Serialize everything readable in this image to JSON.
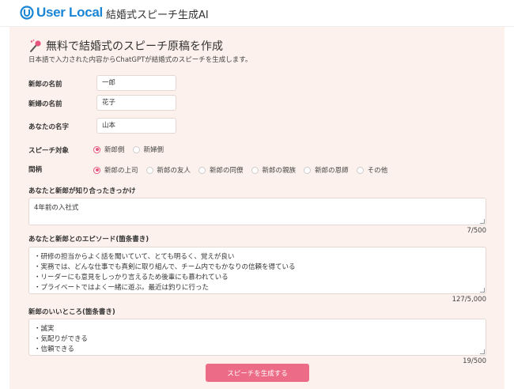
{
  "header": {
    "logo_text": "User Local",
    "app_title": "結婚式スピーチ生成AI",
    "brand_color": "#1a86d6"
  },
  "page": {
    "title": "無料で結婚式のスピーチ原稿を作成",
    "subtitle": "日本語で入力された内容からChatGPTが結婚式のスピーチを生成します。",
    "title_icon": "microphone-icon"
  },
  "form": {
    "groom_name": {
      "label": "新郎の名前",
      "value": "一郎"
    },
    "bride_name": {
      "label": "新婦の名前",
      "value": "花子"
    },
    "your_name": {
      "label": "あなたの名字",
      "value": "山本"
    },
    "speech_target": {
      "label": "スピーチ対象",
      "options": [
        "新郎側",
        "新婦側"
      ],
      "selected": "新郎側"
    },
    "relationship": {
      "label": "間柄",
      "options": [
        "新郎の上司",
        "新郎の友人",
        "新郎の同僚",
        "新郎の親族",
        "新郎の恩師",
        "その他"
      ],
      "selected": "新郎の上司"
    },
    "how_met": {
      "label": "あなたと新郎が知り合ったきっかけ",
      "value": "4年前の入社式",
      "counter": "7/500"
    },
    "episodes": {
      "label": "あなたと新郎とのエピソード(箇条書き)",
      "lines": [
        "・研修の担当からよく話を聞いていて、とても明るく、覚えが良い",
        "・実務では、どんな仕事でも真剣に取り組んで、チーム内でもかなりの信頼を得ている",
        "・リーダーにも意見をしっかり言えるため後輩にも慕われている",
        "・プライベートではよく一緒に遊ぶ。最近は釣りに行った"
      ],
      "counter": "127/5,000"
    },
    "good_points": {
      "label": "新郎のいいところ(箇条書き)",
      "lines": [
        "・誠実",
        "・気配りができる",
        "・信頼できる"
      ],
      "counter": "19/500"
    },
    "submit_label": "スピーチを生成する",
    "accent_color": "#ec6b86"
  }
}
